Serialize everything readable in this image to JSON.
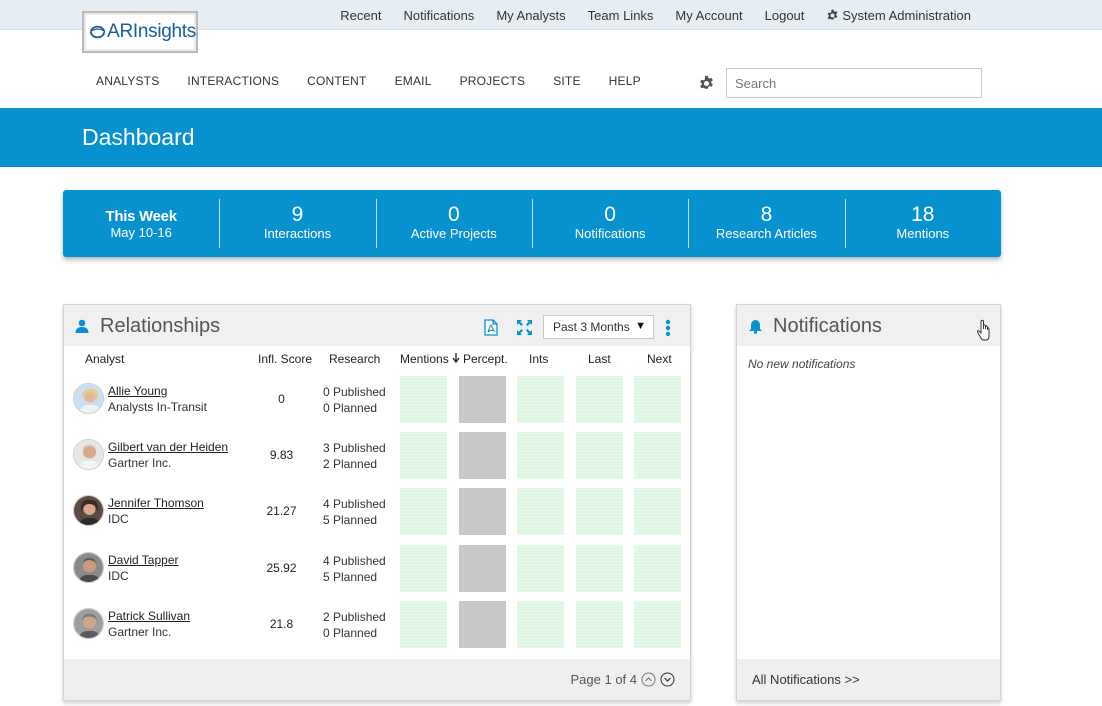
{
  "top_links": [
    "Recent",
    "Notifications",
    "My Analysts",
    "Team Links",
    "My Account",
    "Logout",
    "System Administration"
  ],
  "logo": {
    "text_a": "AR",
    "text_b": "Insights"
  },
  "main_nav": [
    "ANALYSTS",
    "INTERACTIONS",
    "CONTENT",
    "EMAIL",
    "PROJECTS",
    "SITE",
    "HELP"
  ],
  "search": {
    "placeholder": "Search"
  },
  "page_title": "Dashboard",
  "stats": {
    "week_label": "This Week",
    "week_range": "May 10-16",
    "items": [
      {
        "value": "9",
        "label": "Interactions"
      },
      {
        "value": "0",
        "label": "Active Projects"
      },
      {
        "value": "0",
        "label": "Notifications"
      },
      {
        "value": "8",
        "label": "Research Articles"
      },
      {
        "value": "18",
        "label": "Mentions"
      }
    ]
  },
  "relationships": {
    "title": "Relationships",
    "range": "Past 3 Months",
    "columns": [
      "Analyst",
      "Infl. Score",
      "Research",
      "Mentions",
      "Percept.",
      "Ints",
      "Last",
      "Next"
    ],
    "rows": [
      {
        "name": "Allie Young",
        "firm": "Analysts In-Transit",
        "score": "0",
        "published": "0 Published",
        "planned": "0 Planned"
      },
      {
        "name": "Gilbert van der Heiden",
        "firm": "Gartner Inc.",
        "score": "9.83",
        "published": "3 Published",
        "planned": "2 Planned"
      },
      {
        "name": "Jennifer Thomson",
        "firm": "IDC",
        "score": "21.27",
        "published": "4 Published",
        "planned": "5 Planned"
      },
      {
        "name": "David Tapper",
        "firm": "IDC",
        "score": "25.92",
        "published": "4 Published",
        "planned": "5 Planned"
      },
      {
        "name": "Patrick Sullivan",
        "firm": "Gartner Inc.",
        "score": "21.8",
        "published": "2 Published",
        "planned": "0 Planned"
      }
    ],
    "pager": "Page 1 of 4"
  },
  "notifications": {
    "title": "Notifications",
    "empty_text": "No new notifications",
    "footer_link": "All Notifications >>"
  },
  "colors": {
    "brand_blue": "#0891cf",
    "cell_green": "#ddf7e3",
    "cell_grey": "#c8c8c8"
  }
}
